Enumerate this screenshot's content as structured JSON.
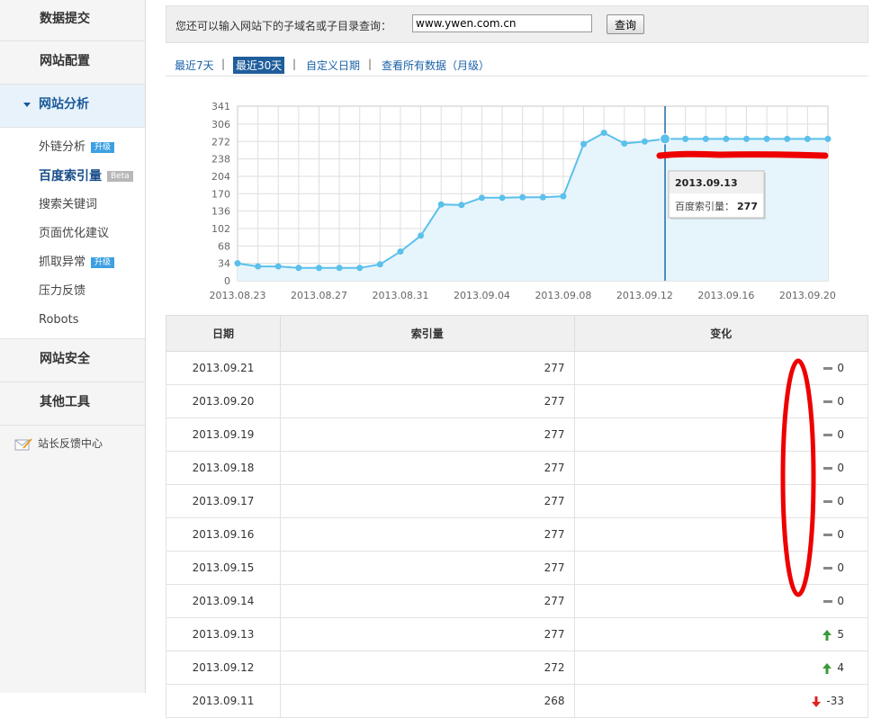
{
  "sidebar": {
    "sections": [
      {
        "label": "数据提交"
      },
      {
        "label": "网站配置"
      },
      {
        "label": "网站分析"
      },
      {
        "label": "网站安全"
      },
      {
        "label": "其他工具"
      }
    ],
    "analysis_items": [
      {
        "label": "外链分析",
        "badge": "升级"
      },
      {
        "label": "百度索引量",
        "badge": "Beta"
      },
      {
        "label": "搜索关键词",
        "badge": ""
      },
      {
        "label": "页面优化建议",
        "badge": ""
      },
      {
        "label": "抓取异常",
        "badge": "升级"
      },
      {
        "label": "压力反馈",
        "badge": ""
      },
      {
        "label": "Robots",
        "badge": ""
      }
    ],
    "feedback": "站长反馈中心"
  },
  "search": {
    "prompt": "您还可以输入网站下的子域名或子目录查询：",
    "value": "www.ywen.com.cn",
    "button": "查询"
  },
  "ranges": {
    "last7": "最近7天",
    "last30": "最近30天",
    "custom": "自定义日期",
    "all": "查看所有数据（月级）",
    "sep": "|"
  },
  "tooltip": {
    "date": "2013.09.13",
    "label": "百度索引量：",
    "value": "277"
  },
  "chart_data": {
    "type": "line",
    "x": [
      "2013.08.23",
      "2013.08.24",
      "2013.08.25",
      "2013.08.26",
      "2013.08.27",
      "2013.08.28",
      "2013.08.29",
      "2013.08.30",
      "2013.08.31",
      "2013.09.01",
      "2013.09.02",
      "2013.09.03",
      "2013.09.04",
      "2013.09.05",
      "2013.09.06",
      "2013.09.07",
      "2013.09.08",
      "2013.09.09",
      "2013.09.10",
      "2013.09.11",
      "2013.09.12",
      "2013.09.13",
      "2013.09.14",
      "2013.09.15",
      "2013.09.16",
      "2013.09.17",
      "2013.09.18",
      "2013.09.19",
      "2013.09.20",
      "2013.09.21"
    ],
    "values": [
      34,
      28,
      28,
      25,
      25,
      25,
      25,
      32,
      57,
      88,
      149,
      148,
      162,
      162,
      163,
      163,
      165,
      267,
      289,
      268,
      272,
      277,
      277,
      277,
      277,
      277,
      277,
      277,
      277,
      277
    ],
    "xticks": [
      "2013.08.23",
      "2013.08.27",
      "2013.08.31",
      "2013.09.04",
      "2013.09.08",
      "2013.09.12",
      "2013.09.16",
      "2013.09.20"
    ],
    "yticks": [
      "341",
      "306",
      "272",
      "238",
      "204",
      "170",
      "136",
      "102",
      "68",
      "34",
      "0"
    ],
    "ylim": [
      0,
      341
    ],
    "grid": true,
    "highlight": "2013.09.13",
    "colors": {
      "line": "#5bc0eb",
      "fill": "#e6f5fc",
      "marker": "#1f6aa5",
      "grid": "#dedede"
    }
  },
  "table": {
    "headers": [
      "日期",
      "索引量",
      "变化"
    ],
    "rows": [
      {
        "date": "2013.09.21",
        "count": "277",
        "change": "0",
        "dir": "flat"
      },
      {
        "date": "2013.09.20",
        "count": "277",
        "change": "0",
        "dir": "flat"
      },
      {
        "date": "2013.09.19",
        "count": "277",
        "change": "0",
        "dir": "flat"
      },
      {
        "date": "2013.09.18",
        "count": "277",
        "change": "0",
        "dir": "flat"
      },
      {
        "date": "2013.09.17",
        "count": "277",
        "change": "0",
        "dir": "flat"
      },
      {
        "date": "2013.09.16",
        "count": "277",
        "change": "0",
        "dir": "flat"
      },
      {
        "date": "2013.09.15",
        "count": "277",
        "change": "0",
        "dir": "flat"
      },
      {
        "date": "2013.09.14",
        "count": "277",
        "change": "0",
        "dir": "flat"
      },
      {
        "date": "2013.09.13",
        "count": "277",
        "change": "5",
        "dir": "up"
      },
      {
        "date": "2013.09.12",
        "count": "272",
        "change": "4",
        "dir": "up"
      },
      {
        "date": "2013.09.11",
        "count": "268",
        "change": "-33",
        "dir": "down"
      }
    ]
  },
  "colors": {
    "up": "#3a9a3a",
    "down": "#e02020",
    "flat": "#888888",
    "annotation": "#ee0000",
    "link": "#1a62a8"
  },
  "icons": {
    "nav_expanded": "triangle-down-icon",
    "feedback": "envelope-pencil-icon",
    "flat": "dash-icon",
    "up": "arrow-up-icon",
    "down": "arrow-down-icon"
  }
}
